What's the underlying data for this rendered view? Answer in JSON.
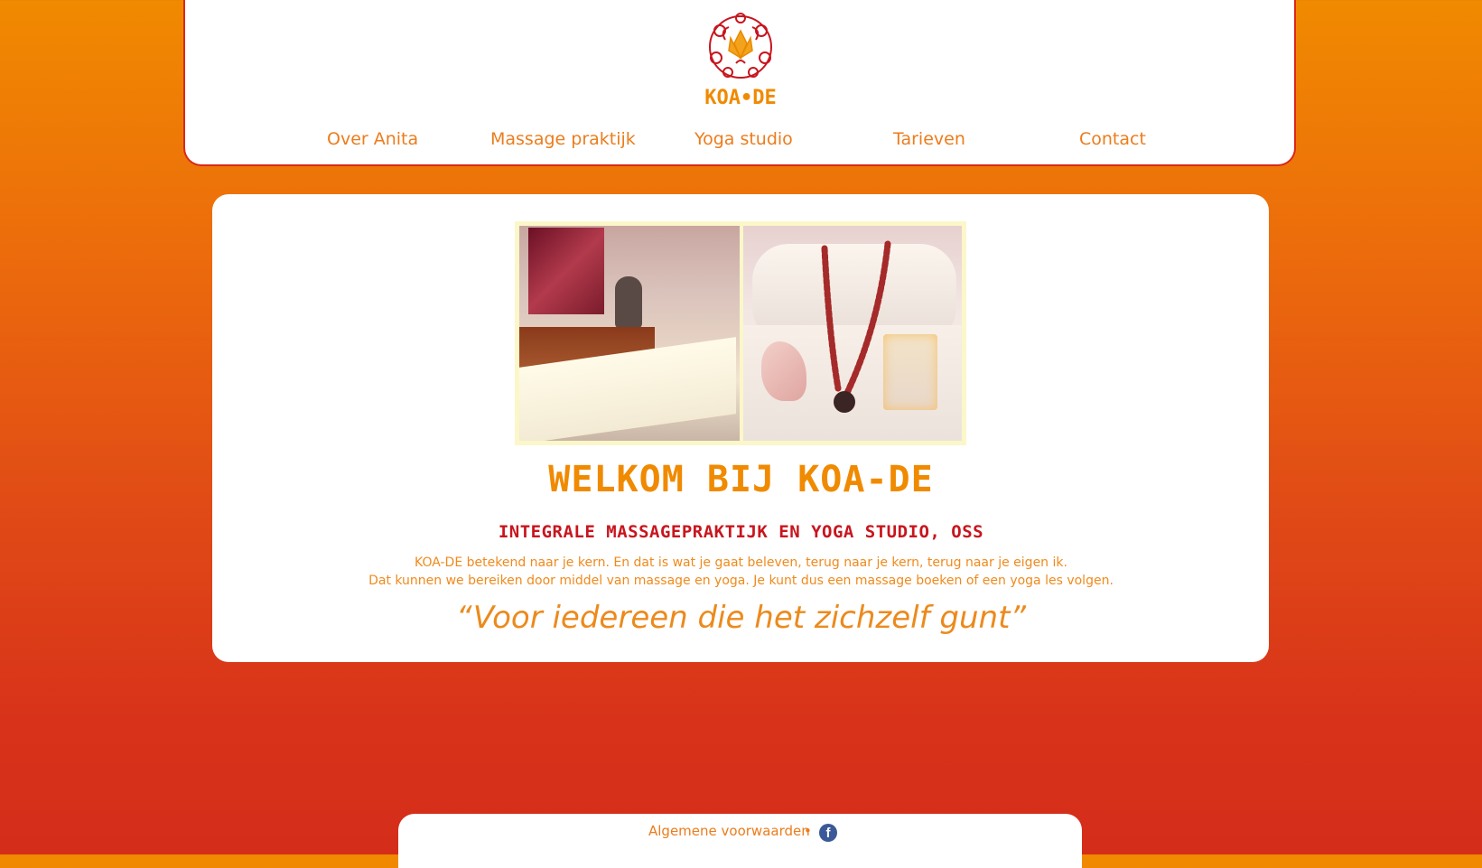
{
  "brand": {
    "name": "KOA•DE"
  },
  "nav": {
    "items": [
      {
        "label": "Over Anita"
      },
      {
        "label": "Massage praktijk"
      },
      {
        "label": "Yoga studio"
      },
      {
        "label": "Tarieven"
      },
      {
        "label": "Contact"
      }
    ]
  },
  "main": {
    "title": "WELKOM BIJ KOA-DE",
    "subtitle": "INTEGRALE MASSAGEPRAKTIJK EN YOGA STUDIO, OSS",
    "body_lines": [
      "KOA-DE betekend naar je kern. En dat is wat je gaat beleven, terug naar je kern, terug naar je eigen ik.",
      "Dat kunnen we bereiken door middel van massage en yoga. Je kunt dus een massage boeken of een yoga les volgen."
    ],
    "quote": "“Voor iedereen die het zichzelf gunt”"
  },
  "footer": {
    "terms_link": "Algemene voorwaarden",
    "separator": "•",
    "facebook_glyph": "f"
  },
  "colors": {
    "accent_orange": "#f08a00",
    "accent_red": "#c8151e",
    "facebook_blue": "#3b5998"
  }
}
